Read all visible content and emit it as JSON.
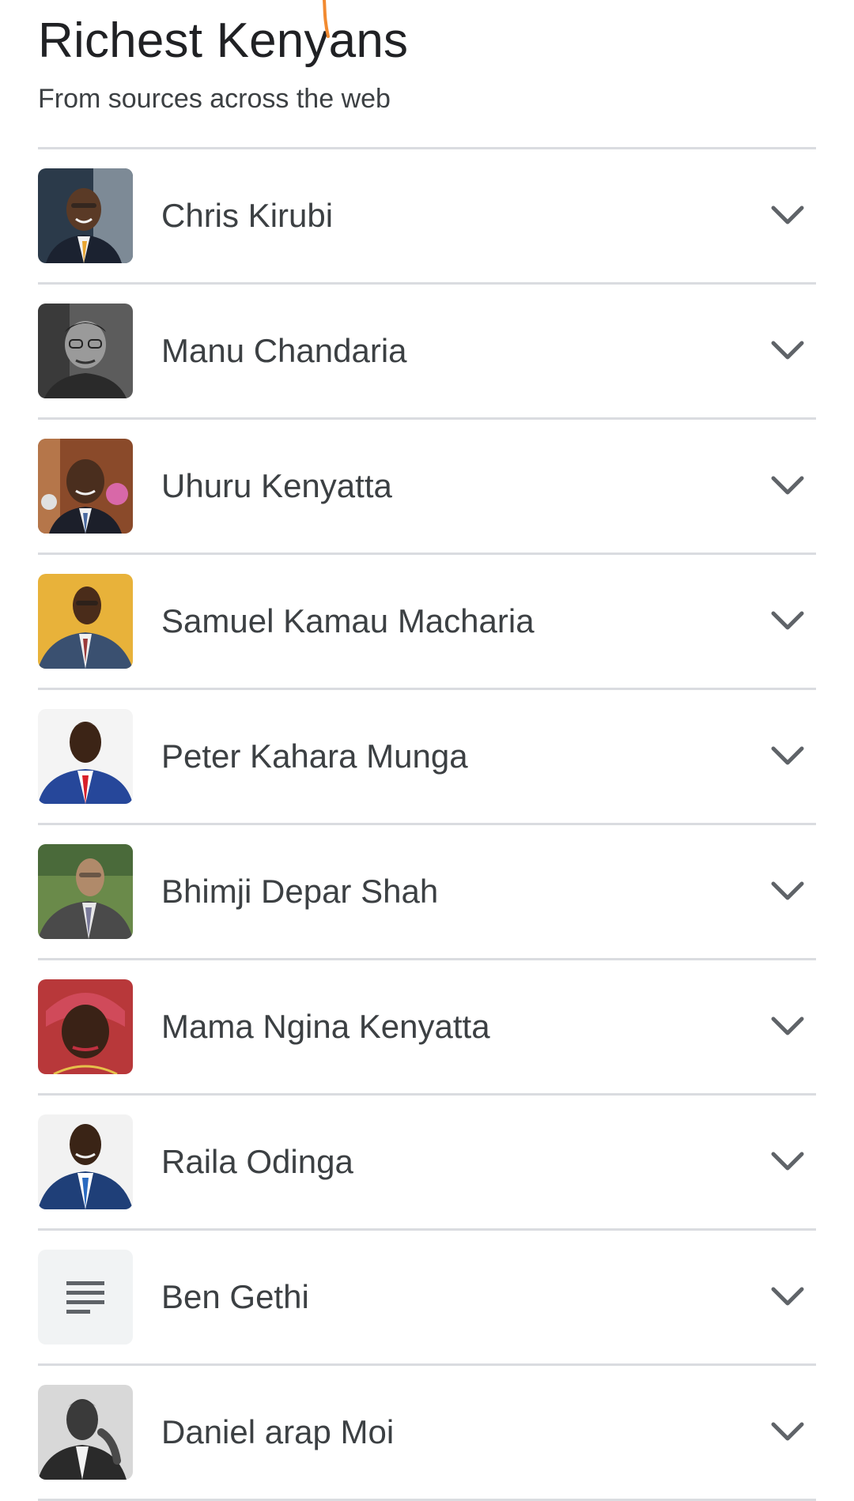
{
  "header": {
    "title": "Richest Kenyans",
    "subtitle": "From sources across the web"
  },
  "colors": {
    "divider": "#dadce0",
    "text_primary": "#202124",
    "text_secondary": "#3c4043",
    "chevron": "#5f6368",
    "scribble": "#f28a30"
  },
  "items": [
    {
      "name": "Chris Kirubi",
      "thumb": "photo",
      "expand_icon": "chevron-down-icon"
    },
    {
      "name": "Manu Chandaria",
      "thumb": "photo",
      "expand_icon": "chevron-down-icon"
    },
    {
      "name": "Uhuru Kenyatta",
      "thumb": "photo",
      "expand_icon": "chevron-down-icon"
    },
    {
      "name": "Samuel Kamau Macharia",
      "thumb": "photo",
      "expand_icon": "chevron-down-icon"
    },
    {
      "name": "Peter Kahara Munga",
      "thumb": "photo",
      "expand_icon": "chevron-down-icon"
    },
    {
      "name": "Bhimji Depar Shah",
      "thumb": "photo",
      "expand_icon": "chevron-down-icon"
    },
    {
      "name": "Mama Ngina Kenyatta",
      "thumb": "photo",
      "expand_icon": "chevron-down-icon"
    },
    {
      "name": "Raila Odinga",
      "thumb": "photo",
      "expand_icon": "chevron-down-icon"
    },
    {
      "name": "Ben Gethi",
      "thumb": "document-icon",
      "expand_icon": "chevron-down-icon"
    },
    {
      "name": "Daniel arap Moi",
      "thumb": "photo",
      "expand_icon": "chevron-down-icon"
    }
  ]
}
